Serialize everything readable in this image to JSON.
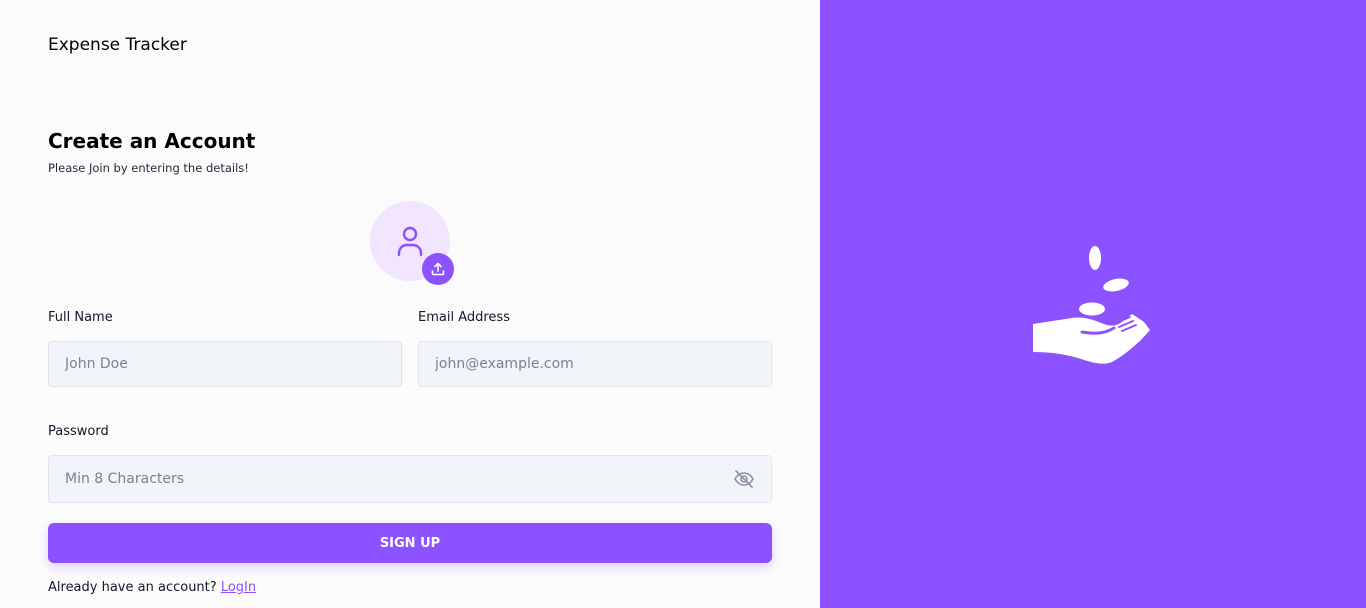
{
  "app": {
    "title": "Expense Tracker"
  },
  "form": {
    "heading": "Create an Account",
    "subheading": "Please Join by entering the details!",
    "avatar": {
      "icon": "user-icon",
      "upload_icon": "upload-icon"
    },
    "full_name": {
      "label": "Full Name",
      "placeholder": "John Doe",
      "value": ""
    },
    "email": {
      "label": "Email Address",
      "placeholder": "john@example.com",
      "value": ""
    },
    "password": {
      "label": "Password",
      "placeholder": "Min 8 Characters",
      "value": "",
      "toggle_icon": "eye-off-icon"
    },
    "submit_label": "SIGN UP",
    "footer_text": "Already have an account?",
    "login_link": "LogIn"
  },
  "illustration": {
    "icon": "hand-coins-icon"
  },
  "colors": {
    "accent": "#8c52ff",
    "avatar_bg": "#f1e5ff",
    "input_bg": "#f1f4f9",
    "page_bg": "#fcfbfc"
  }
}
